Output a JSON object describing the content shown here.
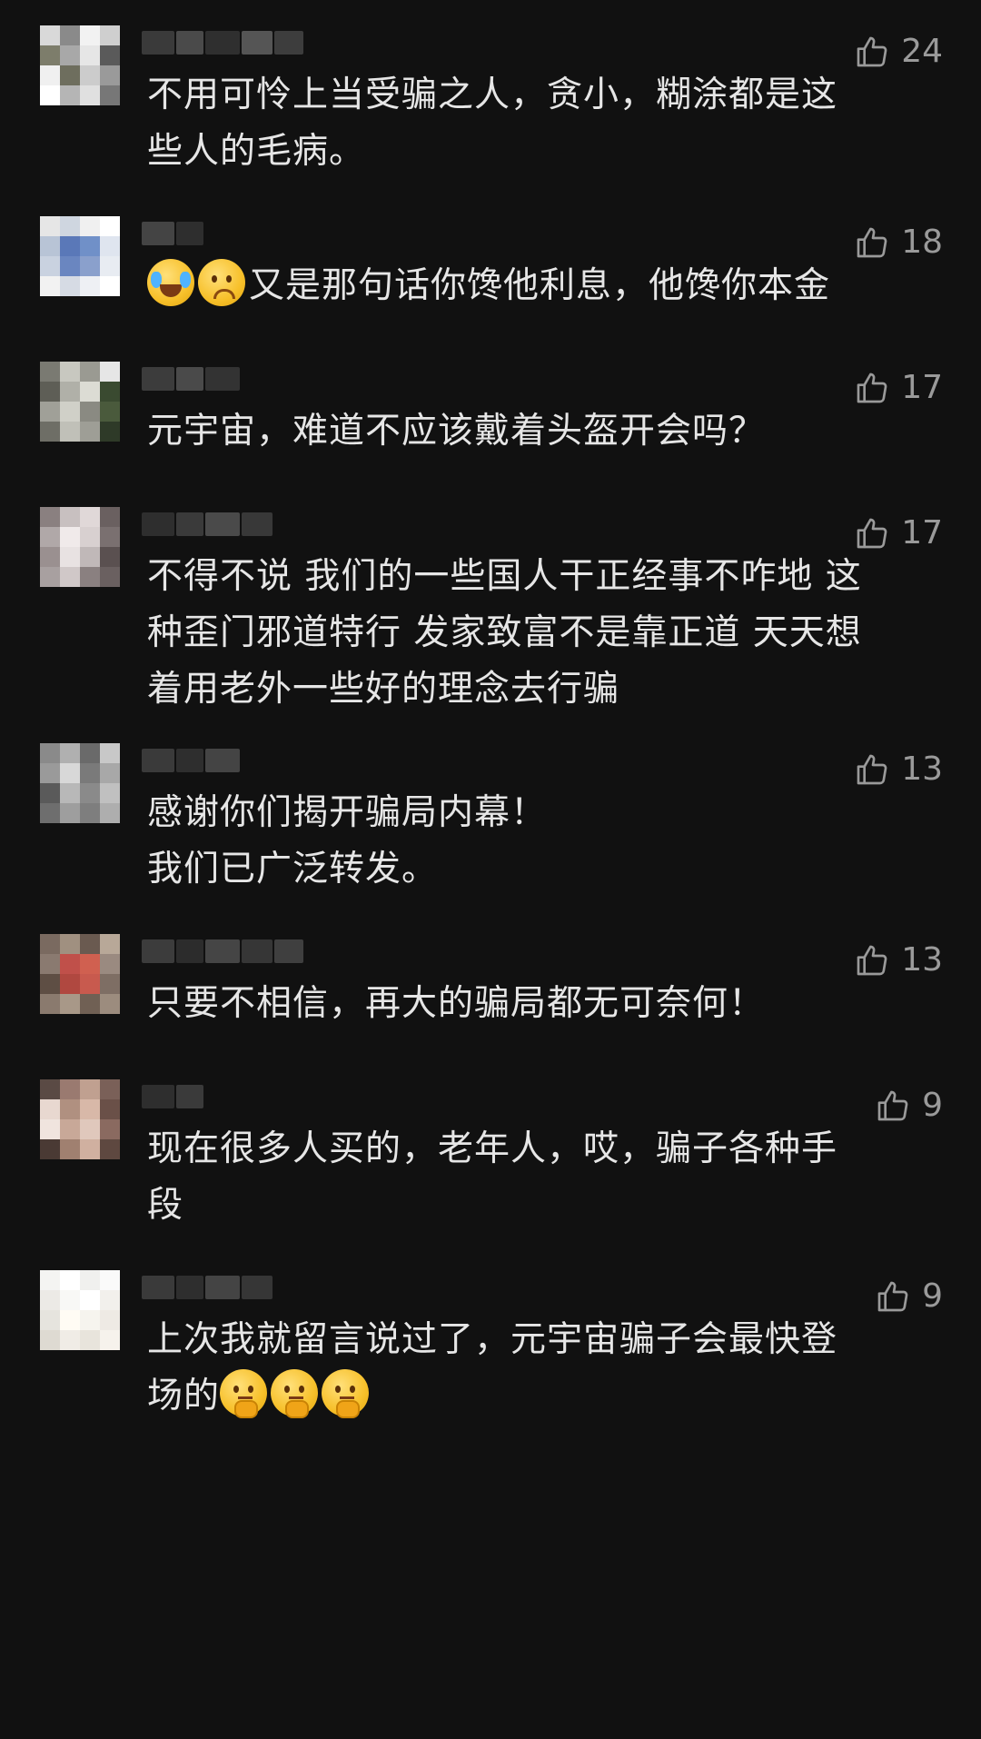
{
  "comments": [
    {
      "likes": "24",
      "text": "不用可怜上当受骗之人，贪小，糊涂都是这\n些人的毛病。",
      "emojis_prefix": [],
      "emojis_suffix": [],
      "avatar_colors": [
        "#d9d9d9",
        "#8a8a8a",
        "#f2f2f2",
        "#cfcfcf",
        "#7d7d6b",
        "#a8a8a8",
        "#e6e6e6",
        "#5a5a5a",
        "#f0f0f0",
        "#6e6e5e",
        "#cccccc",
        "#9a9a9a",
        "#ffffff",
        "#b5b5b5",
        "#e0e0e0",
        "#777777"
      ],
      "name_blocks": [
        "#3a3a3a",
        "#4a4a4a",
        "#2f2f2f",
        "#555555",
        "#3d3d3d"
      ]
    },
    {
      "likes": "18",
      "text": "又是那句话你馋他利息，他馋你本金",
      "emojis_prefix": [
        "loudly-crying-emoji",
        "anxious-face-emoji"
      ],
      "emojis_suffix": [],
      "avatar_colors": [
        "#e6e6e6",
        "#cfd6e0",
        "#f0f0f0",
        "#ffffff",
        "#b8c4d6",
        "#5a78b8",
        "#7090c8",
        "#dfe5ef",
        "#c9d2e0",
        "#6a86c0",
        "#8aa0cc",
        "#e8ecf2",
        "#f2f2f2",
        "#d6dbe4",
        "#eef0f4",
        "#ffffff"
      ],
      "name_blocks": [
        "#444444",
        "#2e2e2e"
      ]
    },
    {
      "likes": "17",
      "text": "元宇宙，难道不应该戴着头盔开会吗？",
      "emojis_prefix": [],
      "emojis_suffix": [],
      "avatar_colors": [
        "#7a7a72",
        "#c8c8c0",
        "#9a9a92",
        "#e6e6e6",
        "#5e5e56",
        "#b0b0a8",
        "#dcdcd4",
        "#3a4a30",
        "#a0a098",
        "#d0d0c8",
        "#8a8a82",
        "#4a5a3c",
        "#6e6e66",
        "#c0c0b8",
        "#9e9e96",
        "#2e3a28"
      ],
      "name_blocks": [
        "#3c3c3c",
        "#4a4a4a",
        "#333333"
      ]
    },
    {
      "likes": "17",
      "text": "不得不说 我们的一些国人干正经事不咋地 这\n种歪门邪道特行 发家致富不是靠正道 天天想\n着用老外一些好的理念去行骗",
      "emojis_prefix": [],
      "emojis_suffix": [],
      "avatar_colors": [
        "#8a8080",
        "#c8c0c0",
        "#e0d8d8",
        "#6a6060",
        "#b0a8a8",
        "#f0eaea",
        "#d8d0d0",
        "#7a7070",
        "#9a9090",
        "#e8e2e2",
        "#c0b8b8",
        "#5a5050",
        "#a8a0a0",
        "#d0c8c8",
        "#8a8080",
        "#6a6060"
      ],
      "name_blocks": [
        "#2e2e2e",
        "#3a3a3a",
        "#4a4a4a",
        "#383838"
      ]
    },
    {
      "likes": "13",
      "text": "感谢你们揭开骗局内幕！\n我们已广泛转发。",
      "emojis_prefix": [],
      "emojis_suffix": [],
      "avatar_colors": [
        "#8a8a8a",
        "#b0b0b0",
        "#6a6a6a",
        "#c8c8c8",
        "#9a9a9a",
        "#d8d8d8",
        "#7a7a7a",
        "#a8a8a8",
        "#5a5a5a",
        "#b8b8b8",
        "#8a8a8a",
        "#c0c0c0",
        "#6e6e6e",
        "#9e9e9e",
        "#7e7e7e",
        "#aeaeae"
      ],
      "name_blocks": [
        "#3a3a3a",
        "#2e2e2e",
        "#444444"
      ]
    },
    {
      "likes": "13",
      "text": "只要不相信，再大的骗局都无可奈何！",
      "emojis_prefix": [],
      "emojis_suffix": [],
      "avatar_colors": [
        "#7a6a60",
        "#a09080",
        "#6a5a50",
        "#b8a898",
        "#8a7a70",
        "#c0504a",
        "#d06050",
        "#9a8a80",
        "#5e4e44",
        "#b04840",
        "#c85a4e",
        "#7e6e64",
        "#8a7a6e",
        "#a89888",
        "#706054",
        "#9c8c7e"
      ],
      "name_blocks": [
        "#3c3c3c",
        "#2c2c2c",
        "#454545",
        "#363636",
        "#3f3f3f"
      ]
    },
    {
      "likes": "9",
      "text": "现在很多人买的，老年人，哎，骗子各种手\n段",
      "emojis_prefix": [],
      "emojis_suffix": [],
      "avatar_colors": [
        "#5a4a44",
        "#9a7a70",
        "#c0a090",
        "#7a6058",
        "#e8d8d0",
        "#b09080",
        "#d8b8a8",
        "#6a5048",
        "#f0e4de",
        "#c8a898",
        "#e0c8bc",
        "#8a6a60",
        "#4a3a34",
        "#a08070",
        "#d0b0a0",
        "#5e4840"
      ],
      "name_blocks": [
        "#2e2e2e",
        "#3a3a3a"
      ]
    },
    {
      "likes": "9",
      "text": "上次我就留言说过了，元宇宙骗子会最快登\n场的",
      "emojis_prefix": [],
      "emojis_suffix": [
        "thinking-face-emoji",
        "thinking-face-emoji",
        "thinking-face-emoji"
      ],
      "avatar_colors": [
        "#f4f4f2",
        "#ffffff",
        "#f0f0ee",
        "#fafafa",
        "#eceae6",
        "#f8f8f6",
        "#ffffff",
        "#f2f0ec",
        "#e6e4de",
        "#fffcf4",
        "#f6f4ee",
        "#eeeae4",
        "#dedad2",
        "#f0ece6",
        "#e8e4dc",
        "#f6f2ec"
      ],
      "name_blocks": [
        "#3a3a3a",
        "#2e2e2e",
        "#444444",
        "#363636"
      ]
    }
  ]
}
